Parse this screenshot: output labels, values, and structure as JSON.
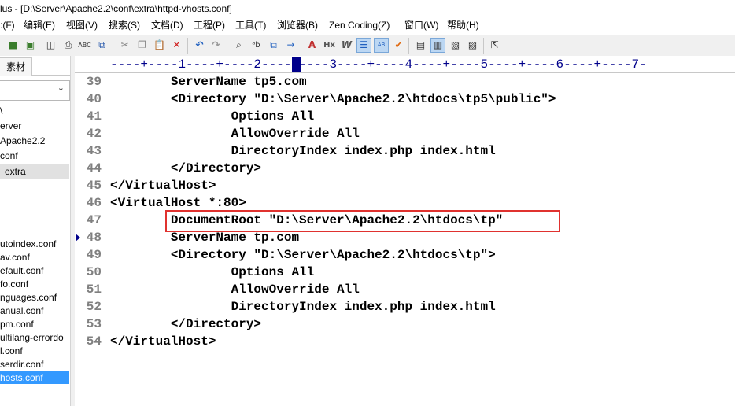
{
  "window": {
    "title": "lus - [D:\\Server\\Apache2.2\\conf\\extra\\httpd-vhosts.conf]"
  },
  "menu": {
    "items": [
      ":(F)",
      "编辑(E)",
      "视图(V)",
      "搜索(S)",
      "文档(D)",
      "工程(P)",
      "工具(T)",
      "浏览器(B)",
      "Zen Coding(Z)",
      "窗口(W)",
      "帮助(H)"
    ]
  },
  "toolbar": {
    "icons": [
      "save-icon",
      "save-all-icon",
      "print-preview-icon",
      "print-icon",
      "spellcheck-icon",
      "clipboard-icon",
      "cut-icon",
      "copy-icon",
      "paste-icon",
      "delete-icon",
      "undo-icon",
      "redo-icon",
      "find-icon",
      "replace-icon",
      "find-in-files-icon",
      "goto-line-icon",
      "font-size-icon",
      "hex-icon",
      "word-wrap-icon",
      "line-numbers-icon",
      "column-mode-icon",
      "spell-check-icon",
      "view-list-icon",
      "view-tree-icon",
      "view-edit-icon",
      "view-output-icon",
      "context-help-icon"
    ]
  },
  "sidebar": {
    "tab_label": "素材",
    "tree": [
      {
        "label": "\\",
        "selected": false
      },
      {
        "label": "erver",
        "selected": false
      },
      {
        "label": "Apache2.2",
        "selected": false
      },
      {
        "label": "conf",
        "selected": false
      },
      {
        "label": "extra",
        "selected": true
      }
    ],
    "files": [
      {
        "label": "utoindex.conf",
        "selected": false
      },
      {
        "label": "av.conf",
        "selected": false
      },
      {
        "label": "efault.conf",
        "selected": false
      },
      {
        "label": "fo.conf",
        "selected": false
      },
      {
        "label": "nguages.conf",
        "selected": false
      },
      {
        "label": "anual.conf",
        "selected": false
      },
      {
        "label": "pm.conf",
        "selected": false
      },
      {
        "label": "ultilang-errordo",
        "selected": false
      },
      {
        "label": "l.conf",
        "selected": false
      },
      {
        "label": "serdir.conf",
        "selected": false
      },
      {
        "label": "hosts.conf",
        "selected": true
      }
    ]
  },
  "editor": {
    "ruler": "----+----1----+----2----+----3----+----4----+----5----+----6----+----7-",
    "ruler_cursor_column": 21,
    "lines": [
      {
        "num": "39",
        "text": "        ServerName tp5.com"
      },
      {
        "num": "40",
        "text": "        <Directory \"D:\\Server\\Apache2.2\\htdocs\\tp5\\public\">"
      },
      {
        "num": "41",
        "text": "                Options All"
      },
      {
        "num": "42",
        "text": "                AllowOverride All"
      },
      {
        "num": "43",
        "text": "                DirectoryIndex index.php index.html"
      },
      {
        "num": "44",
        "text": "        </Directory>"
      },
      {
        "num": "45",
        "text": "</VirtualHost>"
      },
      {
        "num": "46",
        "text": "<VirtualHost *:80>"
      },
      {
        "num": "47",
        "text": "        DocumentRoot \"D:\\Server\\Apache2.2\\htdocs\\tp\""
      },
      {
        "num": "48",
        "text": "        ServerName tp.com"
      },
      {
        "num": "49",
        "text": "        <Directory \"D:\\Server\\Apache2.2\\htdocs\\tp\">"
      },
      {
        "num": "50",
        "text": "                Options All"
      },
      {
        "num": "51",
        "text": "                AllowOverride All"
      },
      {
        "num": "52",
        "text": "                DirectoryIndex index.php index.html"
      },
      {
        "num": "53",
        "text": "        </Directory>"
      },
      {
        "num": "54",
        "text": "</VirtualHost>"
      }
    ],
    "bookmark_line": "48",
    "highlighted_line": "47",
    "highlight_color": "#e0322f"
  }
}
